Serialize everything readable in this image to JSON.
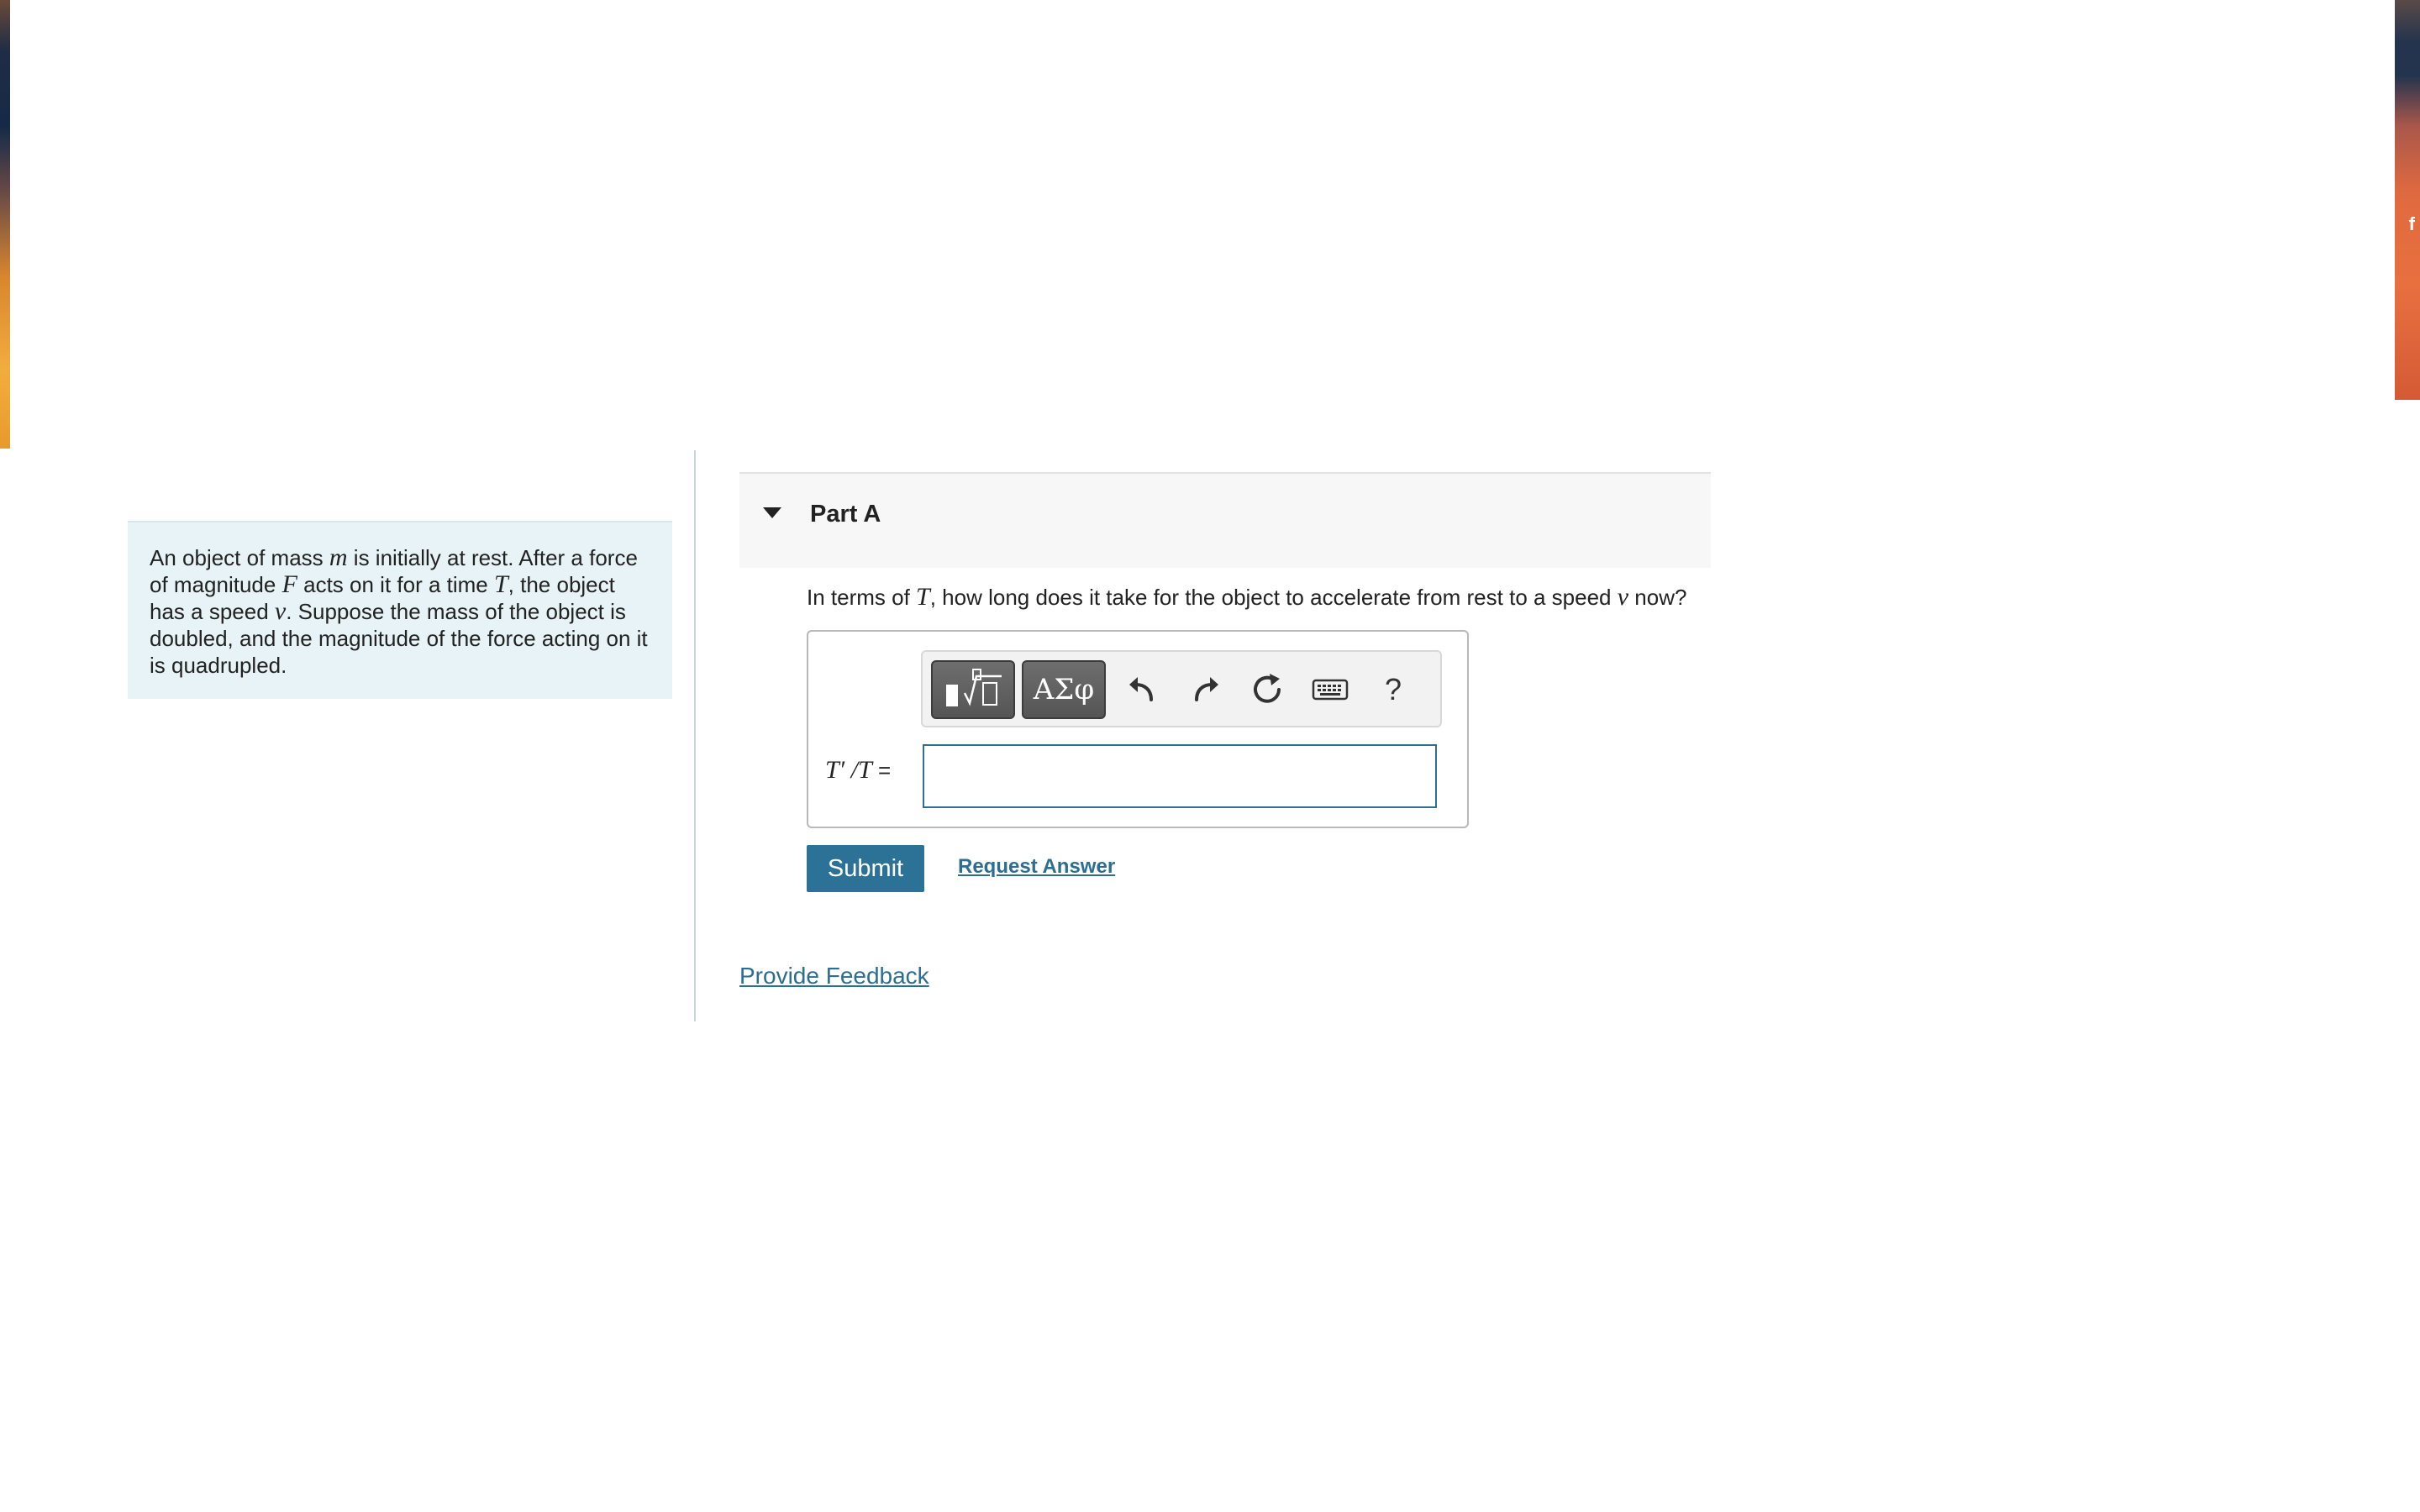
{
  "context": {
    "seg1": "An object of mass ",
    "var_m": "m",
    "seg2": " is initially at rest. After a force of magnitude ",
    "var_F": "F",
    "seg3": " acts on it for a time ",
    "var_T": "T",
    "seg4": ", the object has a speed ",
    "var_v": "v",
    "seg5": ". Suppose the mass of the object is doubled, and the magnitude of the force acting on it is quadrupled."
  },
  "part": {
    "title": "Part A",
    "question_seg1": "In terms of ",
    "question_var_T": "T",
    "question_seg2": ", how long does it take for the object to accelerate from rest to a speed ",
    "question_var_v": "v",
    "question_seg3": " now?"
  },
  "toolbar": {
    "greek_label": "ΑΣφ",
    "help_label": "?"
  },
  "answer": {
    "label_math": "T′ /T",
    "label_eq": " =",
    "value": ""
  },
  "actions": {
    "submit_label": "Submit",
    "request_answer_label": "Request Answer",
    "feedback_label": "Provide Feedback"
  },
  "side_strip_glyph": "f",
  "colors": {
    "accent": "#2c7196",
    "link": "#2c6e92",
    "context_bg": "#e7f3f6"
  }
}
